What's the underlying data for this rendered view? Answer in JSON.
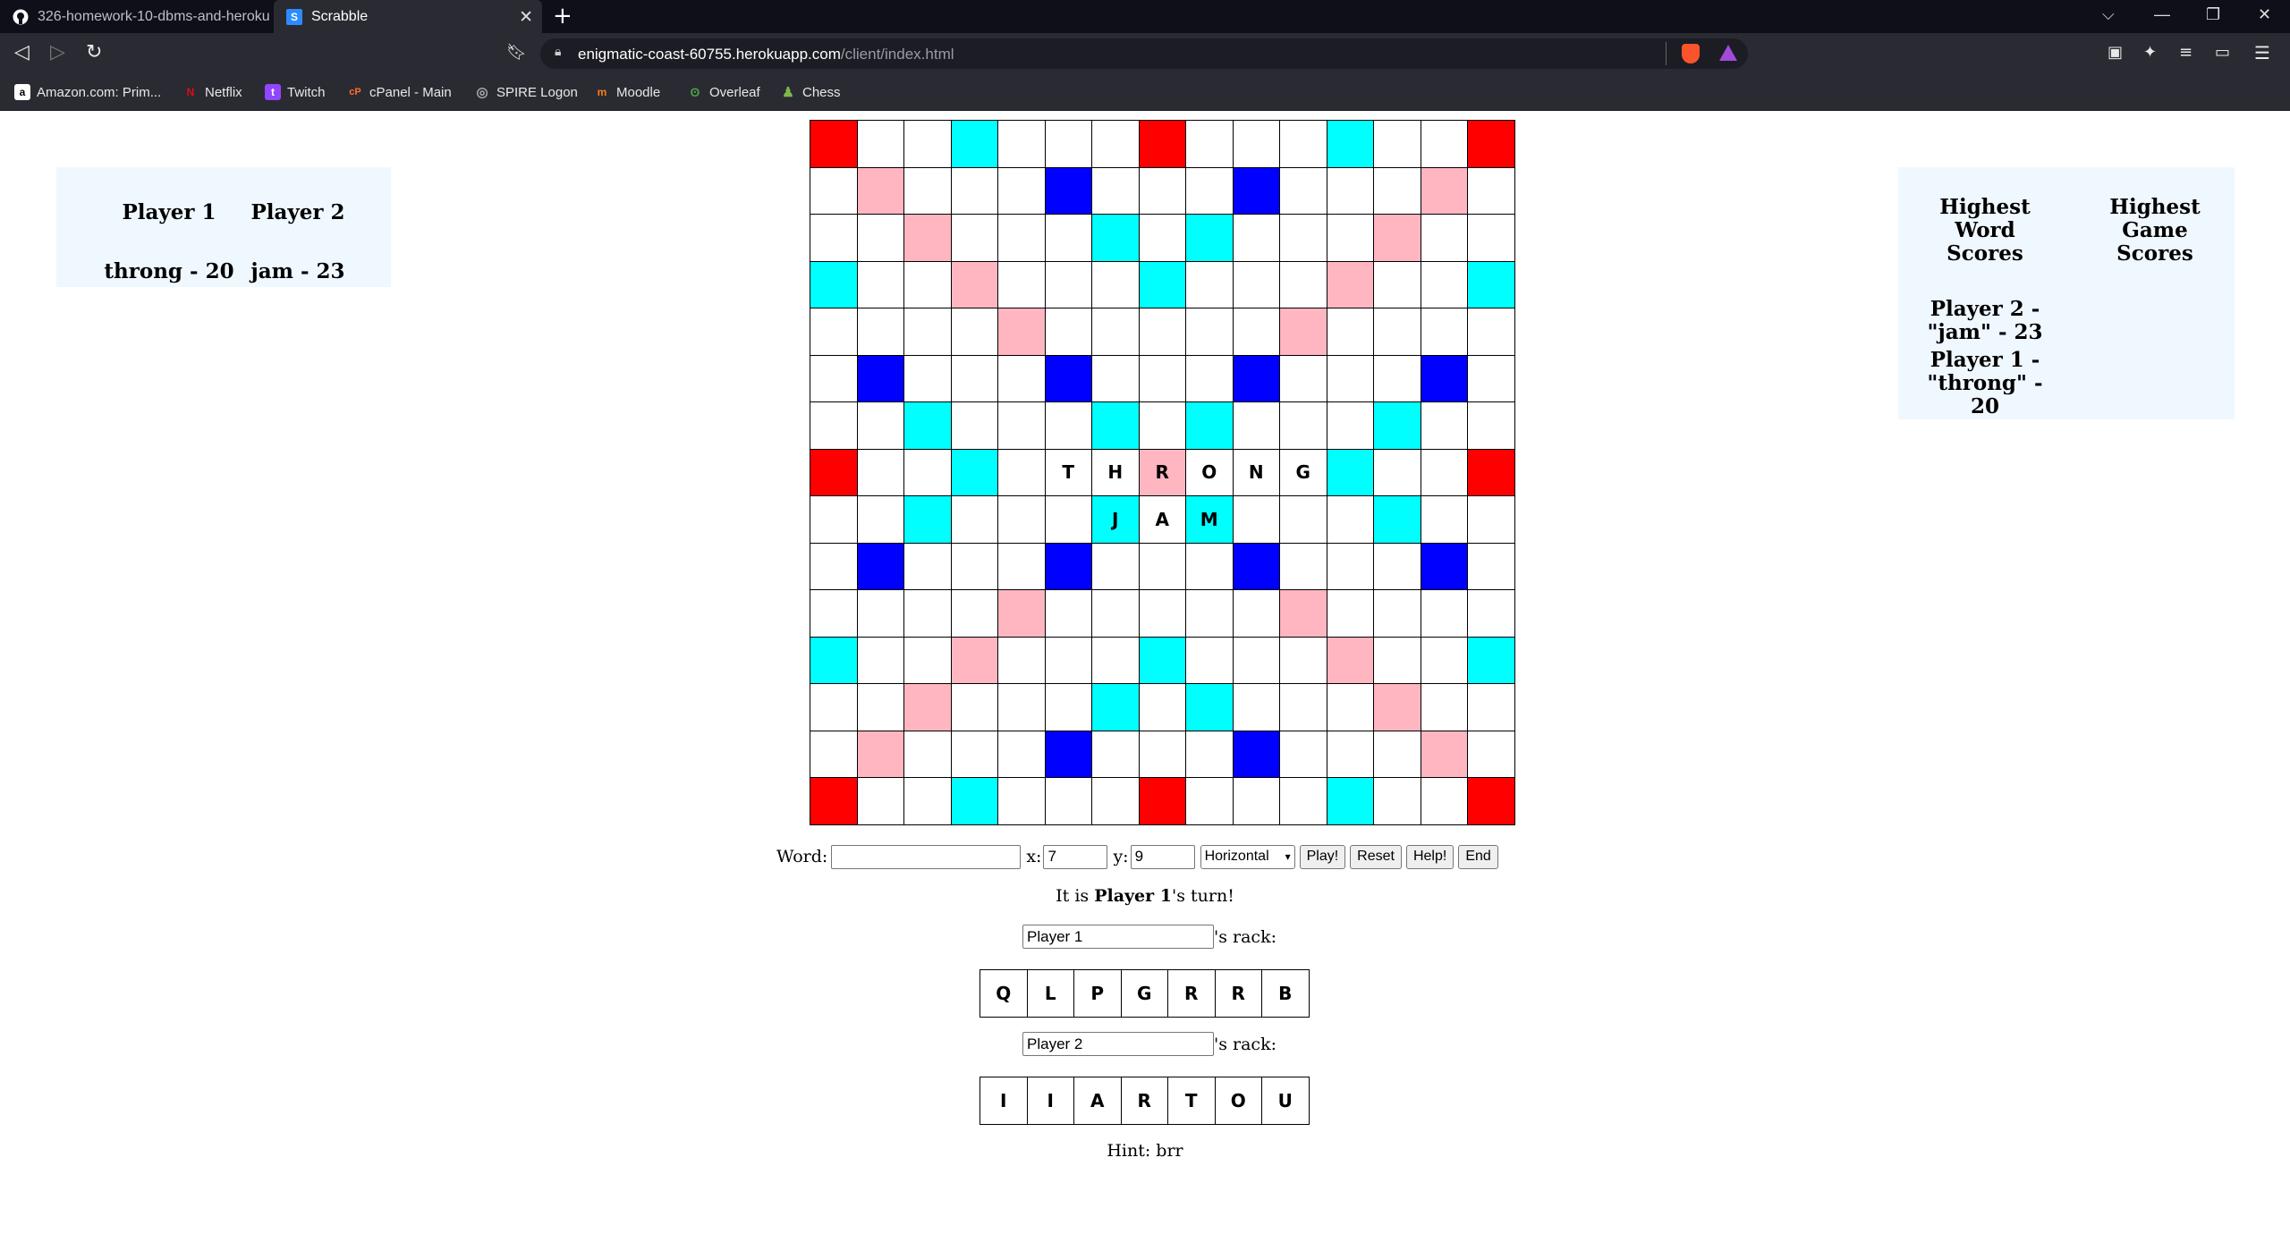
{
  "browser": {
    "tabs": [
      {
        "label": "326-homework-10-dbms-and-heroku",
        "icon": "github-icon"
      },
      {
        "label": "Scrabble",
        "icon": "scrabble-favicon",
        "icon_letter": "S",
        "active": true
      }
    ],
    "url_host": "enigmatic-coast-60755.herokuapp.com",
    "url_path": "/client/index.html",
    "bookmarks": [
      {
        "label": "Amazon.com: Prim...",
        "icon": "amazon-icon",
        "icon_letter": "a"
      },
      {
        "label": "Netflix",
        "icon": "netflix-icon",
        "icon_letter": "N"
      },
      {
        "label": "Twitch",
        "icon": "twitch-icon",
        "icon_letter": "t"
      },
      {
        "label": "cPanel - Main",
        "icon": "cpanel-icon",
        "icon_letter": "cP"
      },
      {
        "label": "SPIRE Logon",
        "icon": "spire-icon",
        "icon_letter": "◎"
      },
      {
        "label": "Moodle",
        "icon": "moodle-icon",
        "icon_letter": "m"
      },
      {
        "label": "Overleaf",
        "icon": "overleaf-icon",
        "icon_letter": "ʘ"
      },
      {
        "label": "Chess",
        "icon": "chess-icon",
        "icon_letter": "♟"
      }
    ]
  },
  "scoreboard": {
    "player1_header": "Player 1",
    "player2_header": "Player 2",
    "player1_score": "throng - 20",
    "player2_score": "jam - 23"
  },
  "highscores": {
    "word_header": "Highest Word Scores",
    "game_header": "Highest Game Scores",
    "word_entries": [
      "Player 2 - \"jam\" - 23",
      "Player 1 - \"throng\" - 20"
    ]
  },
  "colors": {
    "triple_word": "#ff0000",
    "double_word": "#ffb6c1",
    "triple_letter": "#0000ff",
    "double_letter": "#00ffff",
    "plain": "#ffffff"
  },
  "board": {
    "rows": [
      "T...D...T...D...T",
      "x"
    ],
    "layout": [
      "T..d...T...d..T",
      ".D...t...t...D.",
      "..D...d.d...D..",
      "d..D...d...D..d",
      "....D.....D....",
      ".t...t...t...t.",
      "..d...d.d...d..",
      "T..d...D...d..T",
      "..d...d.d...d..",
      ".t...t...t...t.",
      "....D.....D....",
      "d..D...d...D..d",
      "..D...d.d...D..",
      ".D...t...t...D.",
      "T..d...T...d..T"
    ],
    "tiles": [
      {
        "row": 7,
        "col": 5,
        "letter": "T"
      },
      {
        "row": 7,
        "col": 6,
        "letter": "H"
      },
      {
        "row": 7,
        "col": 7,
        "letter": "R"
      },
      {
        "row": 7,
        "col": 8,
        "letter": "O"
      },
      {
        "row": 7,
        "col": 9,
        "letter": "N"
      },
      {
        "row": 7,
        "col": 10,
        "letter": "G"
      },
      {
        "row": 8,
        "col": 6,
        "letter": "J"
      },
      {
        "row": 8,
        "col": 7,
        "letter": "A"
      },
      {
        "row": 8,
        "col": 8,
        "letter": "M"
      }
    ]
  },
  "controls": {
    "word_label": "Word:",
    "word_value": "",
    "x_label": "x:",
    "x_value": "7",
    "y_label": "y:",
    "y_value": "9",
    "direction": "Horizontal",
    "play_label": "Play!",
    "reset_label": "Reset",
    "help_label": "Help!",
    "end_label": "End"
  },
  "turn": {
    "prefix": "It is ",
    "player": "Player 1",
    "suffix": "'s turn!"
  },
  "racks": [
    {
      "name": "Player 1",
      "suffix": "'s rack:",
      "tiles": [
        "Q",
        "L",
        "P",
        "G",
        "R",
        "R",
        "B"
      ]
    },
    {
      "name": "Player 2",
      "suffix": "'s rack:",
      "tiles": [
        "I",
        "I",
        "A",
        "R",
        "T",
        "O",
        "U"
      ]
    }
  ],
  "hint": "Hint: brr"
}
